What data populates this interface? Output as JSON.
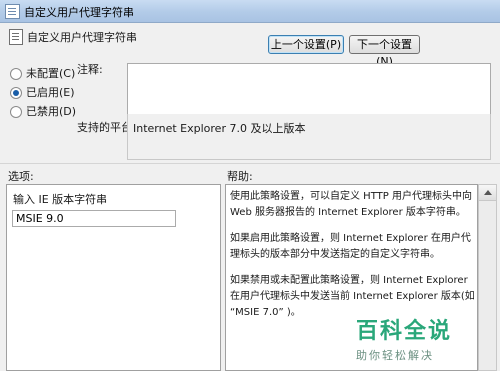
{
  "window": {
    "title": "自定义用户代理字符串",
    "icon": "policy-icon"
  },
  "header": {
    "title": "自定义用户代理字符串",
    "icon": "policy-icon"
  },
  "nav": {
    "prev_label": "上一个设置(P)",
    "next_label": "下一个设置(N)"
  },
  "state": {
    "options": [
      {
        "label": "未配置(C)",
        "checked": false
      },
      {
        "label": "已启用(E)",
        "checked": true
      },
      {
        "label": "已禁用(D)",
        "checked": false
      }
    ]
  },
  "comment": {
    "label": "注释:",
    "value": ""
  },
  "platform": {
    "label": "支持的平台:",
    "value": "Internet Explorer 7.0 及以上版本"
  },
  "options_section": {
    "heading": "选项:",
    "field_label": "输入 IE 版本字符串",
    "field_value": "MSIE 9.0"
  },
  "help_section": {
    "heading": "帮助:",
    "paragraphs": [
      "使用此策略设置，可以自定义 HTTP 用户代理标头中向 Web 服务器报告的 Internet Explorer 版本字符串。",
      "如果启用此策略设置，则 Internet Explorer 在用户代理标头的版本部分中发送指定的自定义字符串。",
      "如果禁用或未配置此策略设置，则 Internet Explorer 在用户代理标头中发送当前 Internet Explorer 版本(如 “MSIE 7.0” )。"
    ]
  },
  "watermark": {
    "title": "百科全说",
    "subtitle": "助你轻松解决"
  },
  "colors": {
    "accent": "#1a5ea8",
    "watermark": "#2aa77a"
  }
}
